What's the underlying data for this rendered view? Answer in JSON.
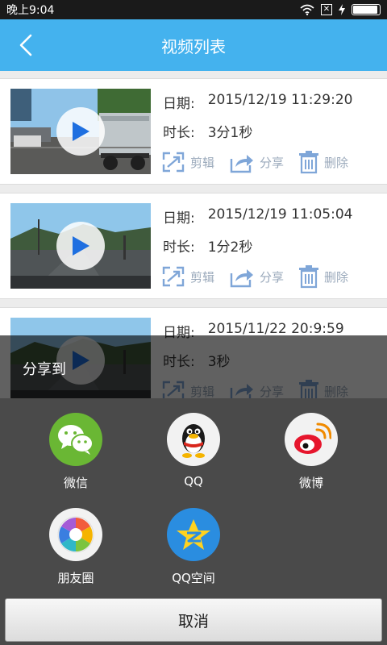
{
  "status_bar": {
    "time": "晚上9:04",
    "icons": [
      "wifi-icon",
      "sim-blocked-icon",
      "charging-icon",
      "battery-icon"
    ],
    "battery_level": 0.95
  },
  "header": {
    "title": "视频列表",
    "back_icon": "chevron-left-icon"
  },
  "labels": {
    "date": "日期:",
    "duration": "时长:"
  },
  "actions": {
    "edit": "剪辑",
    "share": "分享",
    "delete": "删除"
  },
  "videos": [
    {
      "date": "2015/12/19 11:29:20",
      "duration": "3分1秒",
      "scene": "truck-street"
    },
    {
      "date": "2015/12/19 11:05:04",
      "duration": "1分2秒",
      "scene": "mountain-road"
    },
    {
      "date": "2015/11/22 20:9:59",
      "duration": "3秒",
      "scene": "mountain-road"
    }
  ],
  "share_sheet": {
    "title": "分享到",
    "targets": [
      {
        "label": "微信",
        "icon": "wechat-icon"
      },
      {
        "label": "QQ",
        "icon": "qq-penguin-icon"
      },
      {
        "label": "微博",
        "icon": "weibo-icon"
      },
      {
        "label": "朋友圈",
        "icon": "moments-icon"
      },
      {
        "label": "QQ空间",
        "icon": "qzone-icon"
      }
    ],
    "cancel_label": "取消"
  },
  "colors": {
    "header_bg": "#44b2ee",
    "action_icon": "#7fa6d8",
    "play_icon": "#1e6fe0",
    "wechat": "#6ab734",
    "qzone": "#2a8de0"
  }
}
